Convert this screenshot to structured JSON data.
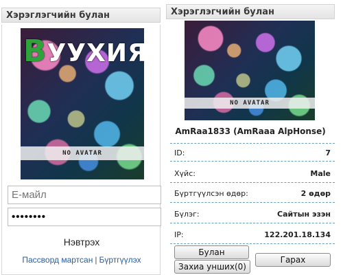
{
  "left_panel": {
    "title": "Хэрэглэгчийн булан",
    "logo": {
      "letter": "B",
      "text": "УУХИЯ.КОМ"
    },
    "avatar_label": "NO AVATAR",
    "email_placeholder": "Е-майл",
    "password_value": "••••••••",
    "login_label": "Нэвтрэх",
    "forgot_password_link": "Пассворд мартсан",
    "separator": "|",
    "register_link": "Бүртгүүлэх"
  },
  "right_panel": {
    "title": "Хэрэглэгчийн булан",
    "avatar_label": "NO AVATAR",
    "username": "AmRaa1833 (AmRaaa AlpHonse)",
    "rows": [
      {
        "key": "ID:",
        "value": "7"
      },
      {
        "key": "Хүйс:",
        "value": "Male"
      },
      {
        "key": "Бүртгүүлсэн өдөр:",
        "value": "2 өдөр"
      },
      {
        "key": "Бүлэг:",
        "value": "Сайтын эзэн"
      },
      {
        "key": "IP:",
        "value": "122.201.18.134"
      }
    ],
    "buttons": {
      "corner": "Булан",
      "messages": "Захиа унших(0)",
      "logout": "Гарах"
    }
  }
}
